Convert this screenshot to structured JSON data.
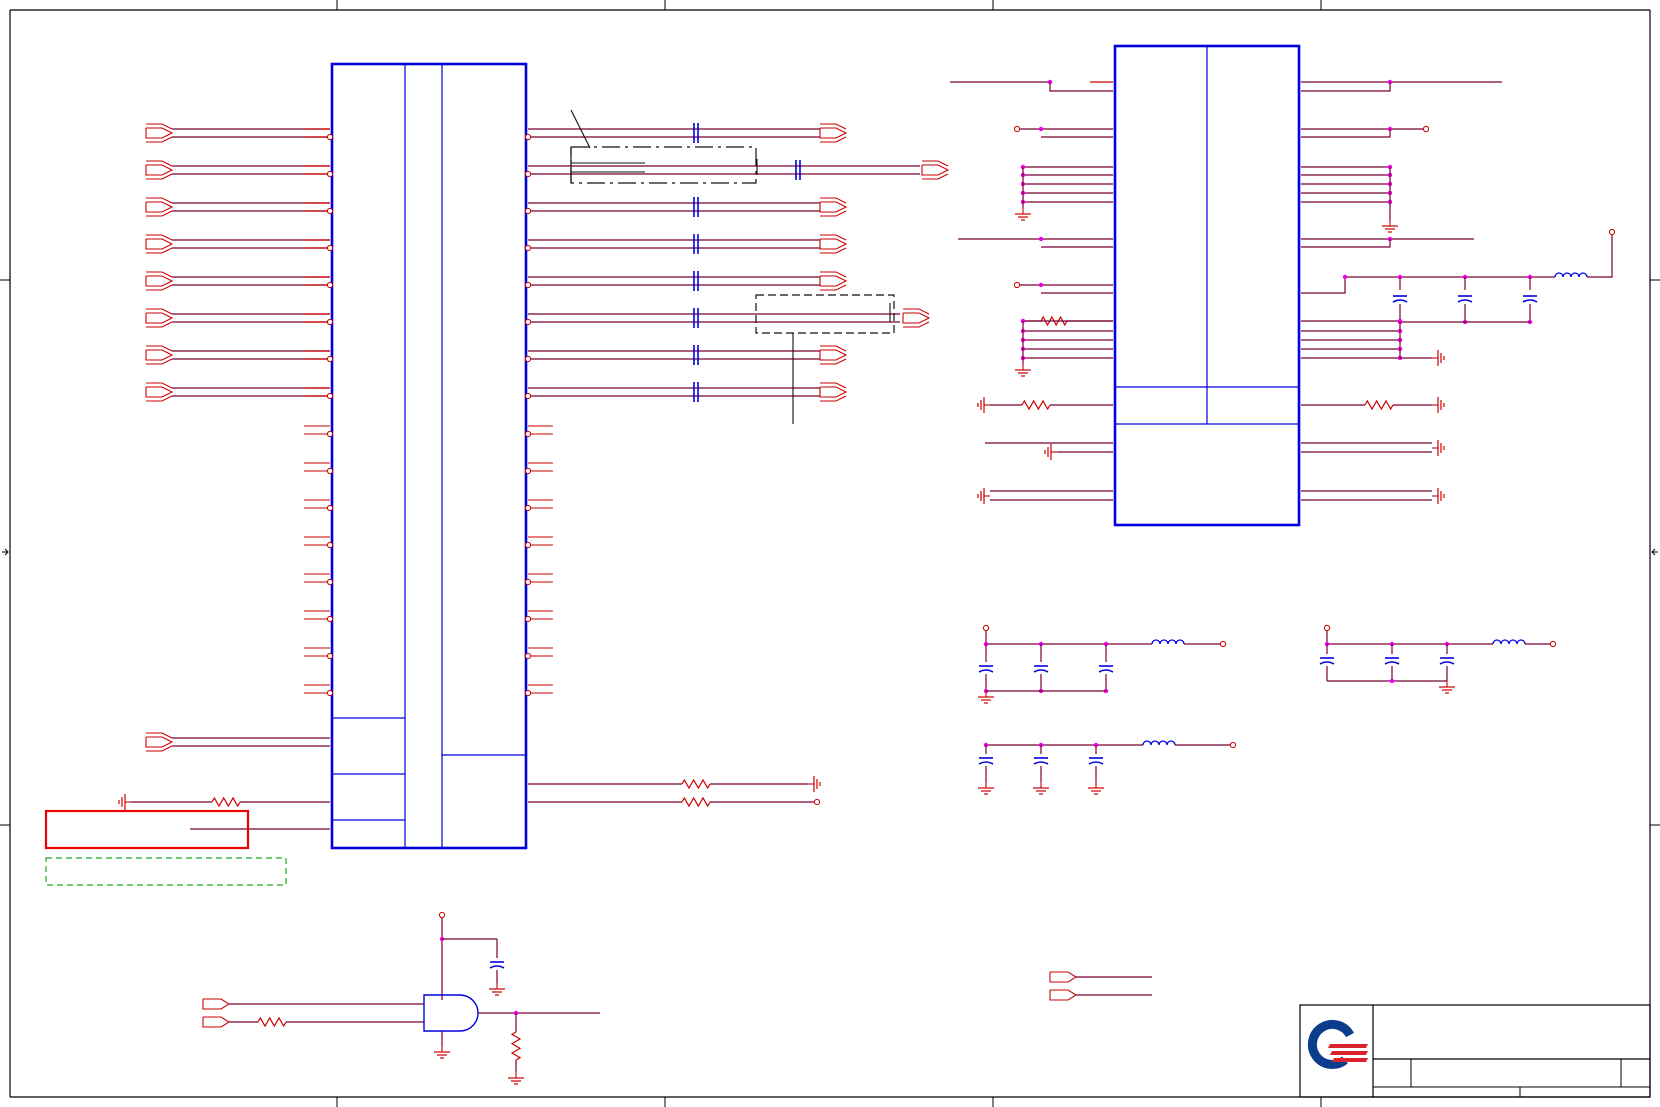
{
  "sheet": {
    "colors": {
      "wire": "#cc0000",
      "net": "#7a0033",
      "part": "#0000dd",
      "junction": "#ee00ee",
      "frame": "#000000",
      "warn_box": "#ee0000",
      "note_box": "#22aa22",
      "logo_blue": "#0b3d8c",
      "logo_red": "#d8232a"
    },
    "components": [
      "connector-block",
      "hdmi-level-shifter-ic",
      "and-gate",
      "dc-blocking-capacitors",
      "decoupling-networks",
      "ferrite-bead-filters",
      "title-block"
    ],
    "icons": [
      "company-logo",
      "ground-symbol",
      "connector-arrow",
      "resistor",
      "capacitor",
      "inductor"
    ]
  }
}
